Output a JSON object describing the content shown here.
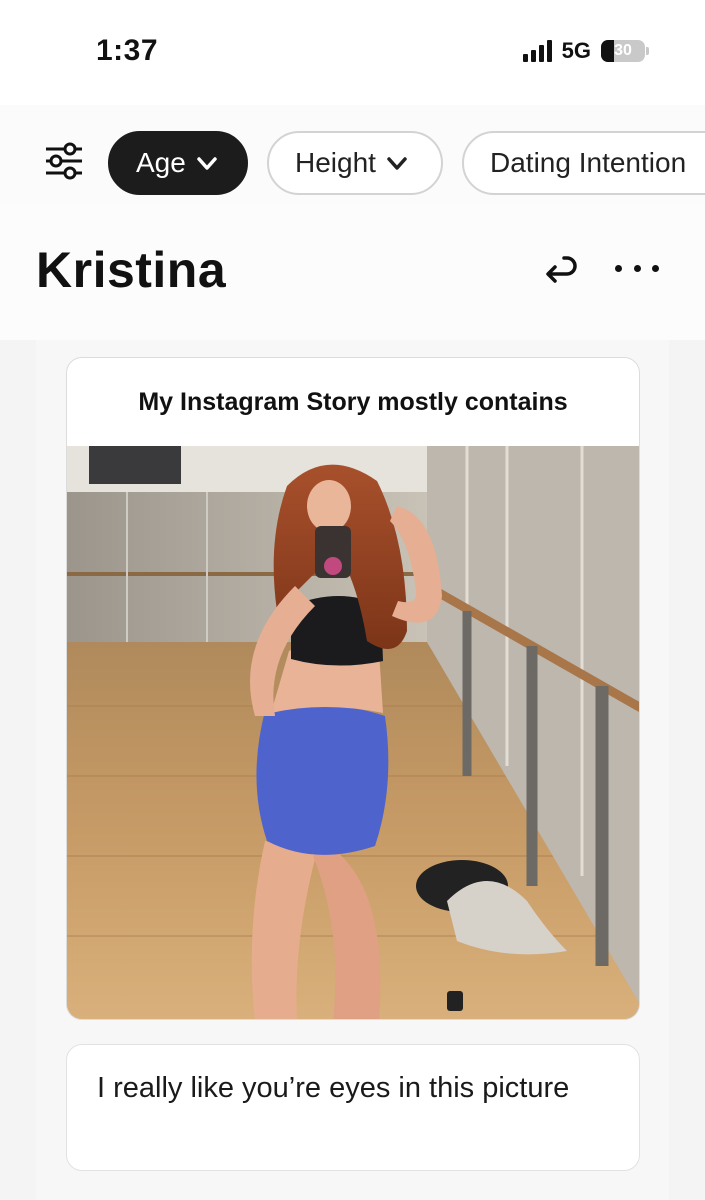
{
  "status_bar": {
    "time": "1:37",
    "network": "5G",
    "battery": "30",
    "battery_level_percent": 30
  },
  "filters": {
    "icon": "sliders-icon",
    "chips": [
      {
        "label": "Age",
        "active": true
      },
      {
        "label": "Height",
        "active": false
      },
      {
        "label": "Dating Intention",
        "active": false
      }
    ]
  },
  "profile": {
    "name": "Kristina",
    "actions": [
      "undo-icon",
      "more-icon"
    ]
  },
  "prompt": {
    "title": "My Instagram Story mostly contains",
    "photo": "mirror-selfie-photo"
  },
  "comment": {
    "text": "I really like you’re eyes in this picture"
  },
  "colors": {
    "active_chip": "#1c1c1c",
    "chip_border": "#d3d3d3",
    "card_background": "#ffffff",
    "page_background": "#f4f4f4"
  }
}
